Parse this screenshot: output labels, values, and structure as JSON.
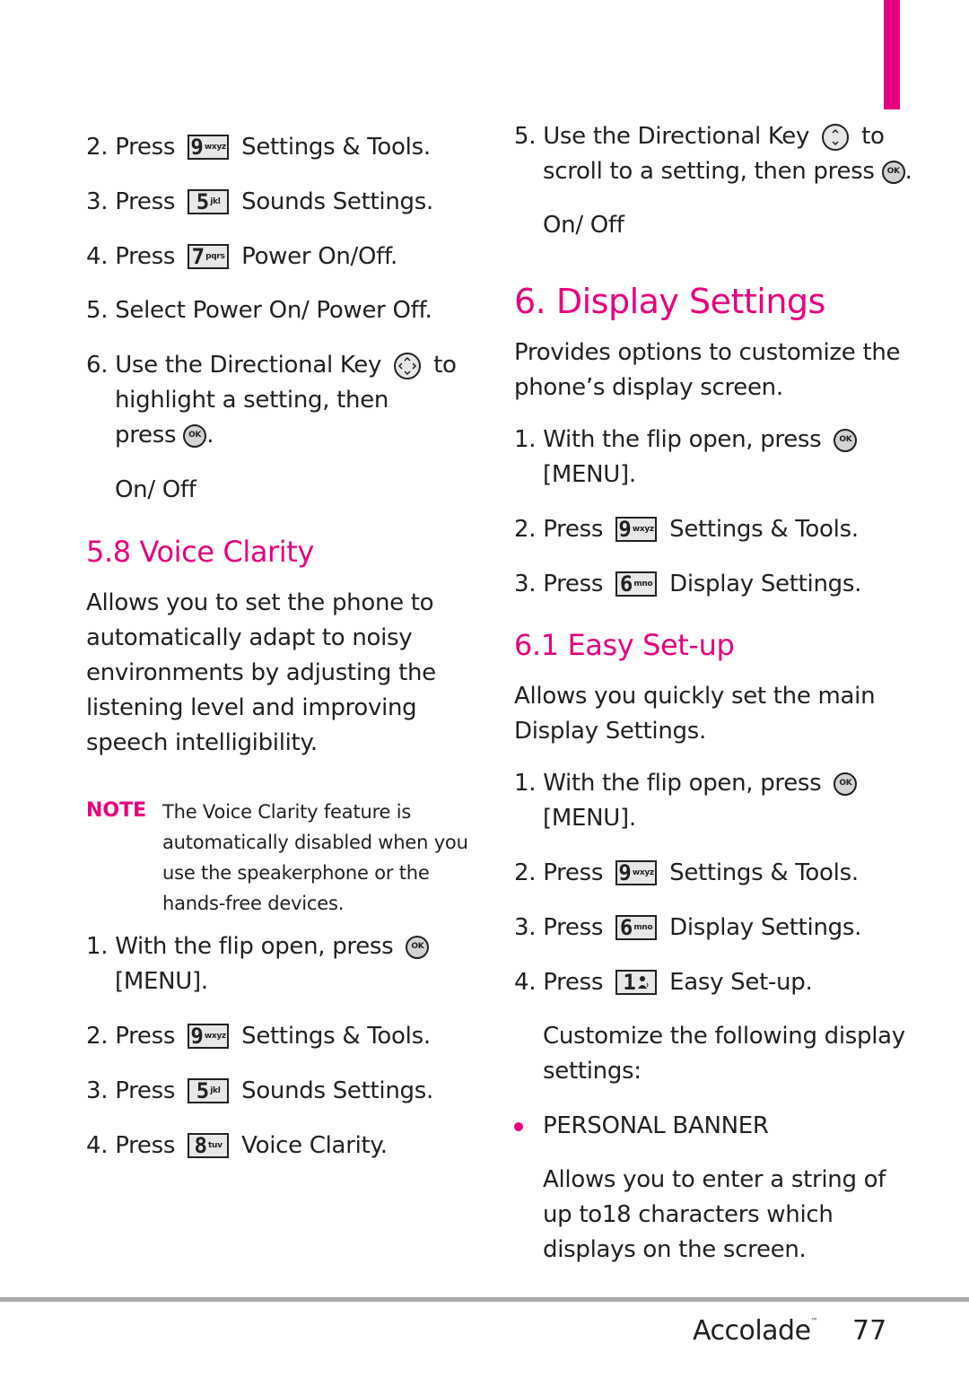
{
  "colors": {
    "accent": "#e6007e",
    "text": "#231f20",
    "rule": "#a7a9ac",
    "key_fill": "#e6e7e8"
  },
  "left": {
    "steps_top": [
      {
        "num": "2.",
        "pre": "Press",
        "key": {
          "digit": "9",
          "letters": "wxyz"
        },
        "label": "Settings & Tools."
      },
      {
        "num": "3.",
        "pre": "Press",
        "key": {
          "digit": "5",
          "letters": "jkl"
        },
        "label": "Sounds Settings."
      },
      {
        "num": "4.",
        "pre": "Press",
        "key": {
          "digit": "7",
          "letters": "pqrs"
        },
        "label": "Power On/Off."
      }
    ],
    "step5": {
      "num": "5.",
      "pre": "Select",
      "label": "Power On/ Power Off."
    },
    "step6": {
      "num": "6.",
      "line1_a": "Use the Directional Key",
      "line1_b": "to",
      "line2": "highlight a setting, then",
      "line3": "press",
      "line3_end": "."
    },
    "option": "On/ Off",
    "section_title": "5.8 Voice Clarity",
    "paragraph": [
      "Allows you to set the phone to",
      "automatically adapt to noisy",
      "environments by adjusting the",
      "listening level and improving",
      "speech intelligibility."
    ],
    "note": {
      "label": "NOTE",
      "lines": [
        "The Voice Clarity feature is",
        "automatically disabled when you",
        "use the speakerphone or the",
        "hands-free devices."
      ]
    },
    "step1": {
      "num": "1.",
      "text": "With the flip open, press",
      "line2": "[MENU]."
    },
    "steps_bottom": [
      {
        "num": "2.",
        "pre": "Press",
        "key": {
          "digit": "9",
          "letters": "wxyz"
        },
        "label": "Settings & Tools."
      },
      {
        "num": "3.",
        "pre": "Press",
        "key": {
          "digit": "5",
          "letters": "jkl"
        },
        "label": "Sounds Settings."
      },
      {
        "num": "4.",
        "pre": "Press",
        "key": {
          "digit": "8",
          "letters": "tuv"
        },
        "label": "Voice Clarity."
      }
    ]
  },
  "right": {
    "step5": {
      "num": "5.",
      "line1_a": "Use the Directional Key",
      "line1_b": "to",
      "line2": "scroll to a setting, then press",
      "line2_end": "."
    },
    "option": "On/ Off",
    "chapter_title": "6. Display Settings",
    "chapter_intro": [
      "Provides options to customize the",
      "phone’s display screen."
    ],
    "step1": {
      "num": "1.",
      "text": "With the flip open, press",
      "line2": "[MENU]."
    },
    "steps_a": [
      {
        "num": "2.",
        "pre": "Press",
        "key": {
          "digit": "9",
          "letters": "wxyz"
        },
        "label": "Settings & Tools."
      },
      {
        "num": "3.",
        "pre": "Press",
        "key": {
          "digit": "6",
          "letters": "mno"
        },
        "label": "Display Settings."
      }
    ],
    "section_title": "6.1 Easy Set-up",
    "section_intro": [
      "Allows you quickly set the main",
      "Display Settings."
    ],
    "step1b": {
      "num": "1.",
      "text": "With the flip open, press",
      "line2": "[MENU]."
    },
    "steps_b": [
      {
        "num": "2.",
        "pre": "Press",
        "key": {
          "digit": "9",
          "letters": "wxyz"
        },
        "label": "Settings & Tools."
      },
      {
        "num": "3.",
        "pre": "Press",
        "key": {
          "digit": "6",
          "letters": "mno"
        },
        "label": "Display Settings."
      },
      {
        "num": "4.",
        "pre": "Press",
        "key": {
          "digit": "1",
          "letters": "voicemail"
        },
        "label": "Easy Set-up."
      }
    ],
    "customize": [
      "Customize the following display",
      "settings:"
    ],
    "bullet_title": "PERSONAL BANNER",
    "bullet_desc": [
      "Allows you to enter a string of",
      "up to18 characters which",
      "displays on the screen."
    ]
  },
  "footer": {
    "brand": "Accolade",
    "trademark": "™",
    "page_number": "77"
  }
}
